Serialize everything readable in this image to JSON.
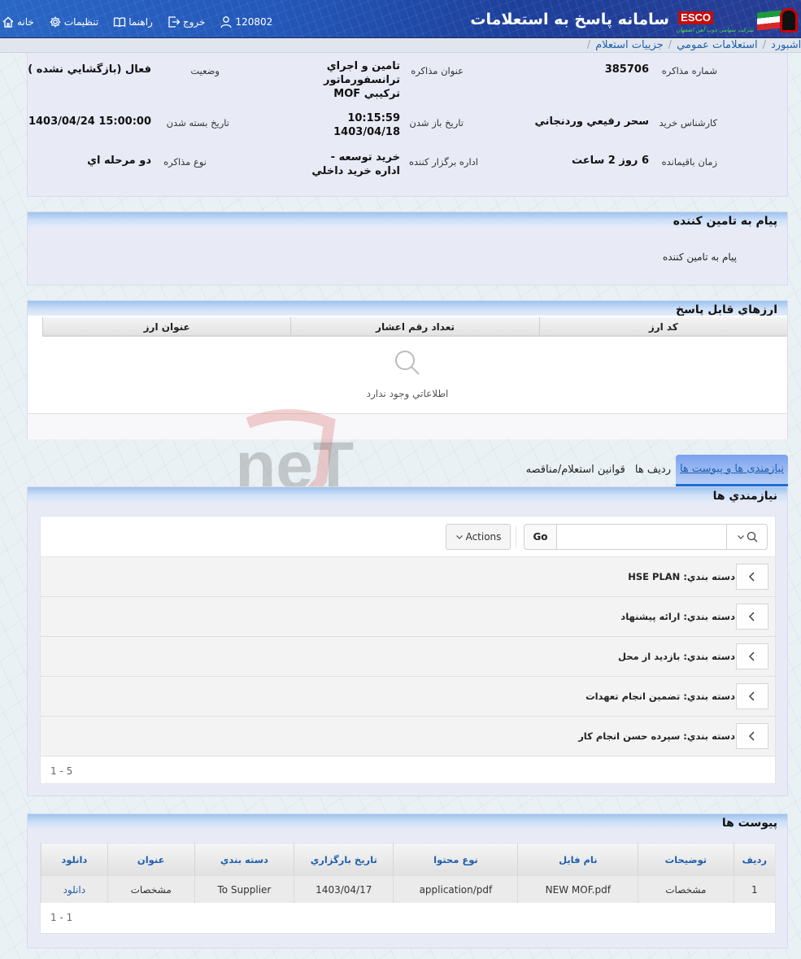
{
  "header": {
    "app_title": "سامانه پاسخ به استعلامات",
    "brand": "ESCO",
    "company_tag": "شرکت سهامی ذوب آهن اصفهان",
    "nav": [
      {
        "label": "خانه",
        "icon": "home-icon"
      },
      {
        "label": "تنظيمات",
        "icon": "gear-icon"
      },
      {
        "label": "راهنما",
        "icon": "book-icon"
      },
      {
        "label": "خروج",
        "icon": "logout-icon"
      },
      {
        "label": "120802",
        "icon": "user-icon"
      }
    ]
  },
  "breadcrumb": [
    "داشبورد",
    "استعلامات عمومي",
    "جزييات استعلام"
  ],
  "info": {
    "fields": [
      {
        "label": "شماره مذاکره",
        "value": "385706"
      },
      {
        "label": "عنوان مذاکره",
        "value": "تامين و اجراي ترانسفورماتور ترکيبي MOF"
      },
      {
        "label": "وضعيت",
        "value": "فعال (بازگشايي نشده )"
      },
      {
        "label": "کارشناس خريد",
        "value": "سحر رفيعي وردنجاني"
      },
      {
        "label": "تاريخ باز شدن",
        "value": "10:15:59 1403/04/18"
      },
      {
        "label": "تاريخ بسته شدن",
        "value": "1403/04/24 15:00:00"
      },
      {
        "label": "زمان باقيمانده",
        "value": "6 روز 2 ساعت"
      },
      {
        "label": "اداره برگزار کننده",
        "value": "خريد توسعه - اداره خريد داخلي"
      },
      {
        "label": "نوع مذاکره",
        "value": "دو مرحله اي"
      }
    ]
  },
  "message_panel": {
    "title": "پيام به تامين کننده",
    "text": "پيام به تامين کننده"
  },
  "currency_panel": {
    "title": "ارزهاي قابل پاسخ",
    "columns": [
      "کد ارز",
      "تعداد رقم اعشار",
      "عنوان ارز"
    ],
    "empty_text": "اطلاعاتي وجود ندارد"
  },
  "tabs": [
    {
      "label": "نيازمندی ها و پيوست ها",
      "active": true
    },
    {
      "label": "رديف ها",
      "active": false
    },
    {
      "label": "قوانين استعلام/مناقصه",
      "active": false
    }
  ],
  "needs_panel": {
    "title": "نيازمندي ها",
    "search_placeholder": "",
    "go_label": "Go",
    "actions_label": "Actions",
    "groups": [
      "دسته بندي: HSE PLAN",
      "دسته بندي: ارائه پيشنهاد",
      "دسته بندي: بازديد از محل",
      "دسته بندي: تضمين انجام تعهدات",
      "دسته بندي: سپرده حسن انجام کار"
    ],
    "pagination": "1 - 5"
  },
  "attachments_panel": {
    "title": "پيوست ها",
    "columns": [
      "رديف",
      "توضيحات",
      "نام فايل",
      "نوع محتوا",
      "تاريخ بارگزاري",
      "دسته بندي",
      "عنوان",
      "دانلود"
    ],
    "rows": [
      [
        "1",
        "مشخصات",
        "NEW MOF.pdf",
        "application/pdf",
        "1403/04/17",
        "To Supplier",
        "مشخصات",
        "دانلود"
      ]
    ],
    "pagination": "1 - 1"
  },
  "watermark": "AriaTender.neT",
  "colors": {
    "accent": "#1f5fae",
    "header_bg": "#2457b8",
    "panel_bg": "#e8eaf6",
    "brand_red": "#c40d0d"
  }
}
